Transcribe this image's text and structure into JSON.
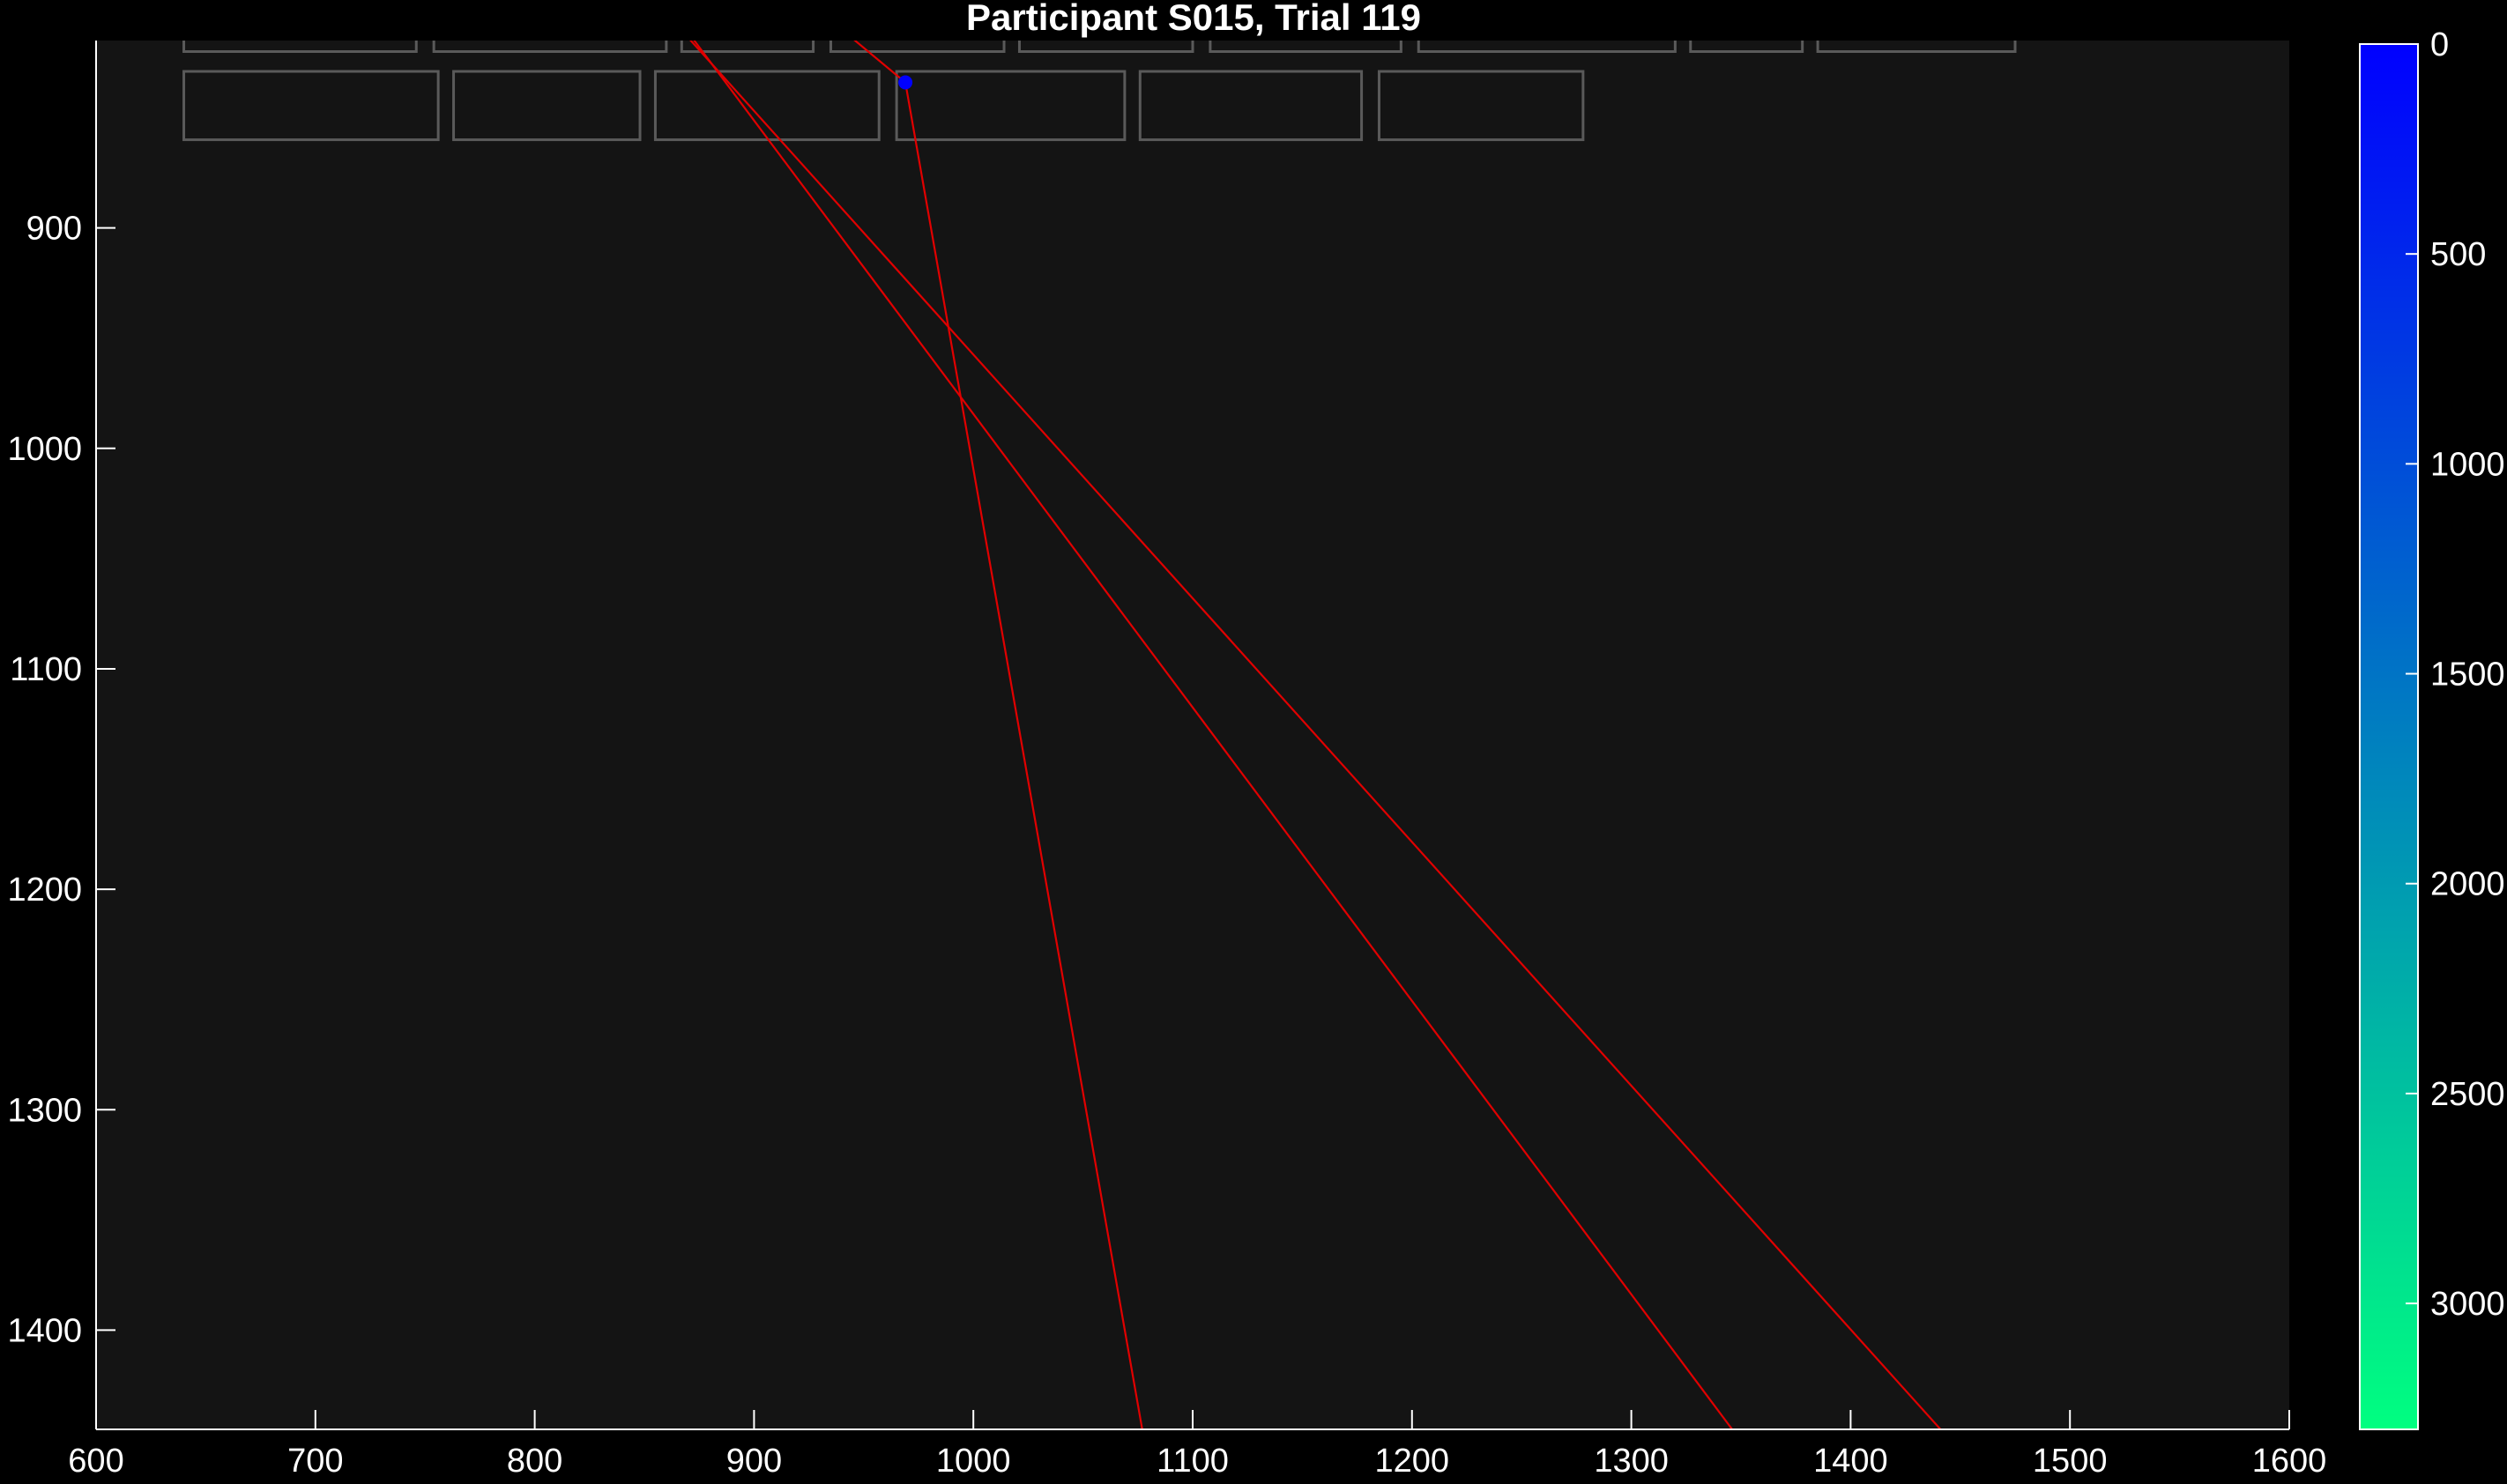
{
  "chart_data": {
    "type": "scatter",
    "title": "Participant S015, Trial 119",
    "xlabel": "",
    "ylabel": "",
    "xlim": [
      600,
      1600
    ],
    "ylim": [
      1445,
      815
    ],
    "y_direction": "reversed",
    "grid": false,
    "x_ticks": [
      600,
      700,
      800,
      900,
      1000,
      1100,
      1200,
      1300,
      1400,
      1500,
      1600
    ],
    "y_ticks": [
      900,
      1000,
      1100,
      1200,
      1300,
      1400
    ],
    "colors": {
      "background": "#000000",
      "axes_background": "#141414",
      "axis": "#ffffff",
      "text_boxes": "#5a5a5a",
      "saccade_line": "#e00000",
      "fixation_start": "#0000ff"
    },
    "text_boxes": [
      {
        "row": 1,
        "x0": 640,
        "x1": 746,
        "y0": 791,
        "y1": 820
      },
      {
        "row": 1,
        "x0": 754,
        "x1": 860,
        "y0": 791,
        "y1": 820
      },
      {
        "row": 1,
        "x0": 867,
        "x1": 927,
        "y0": 791,
        "y1": 820
      },
      {
        "row": 1,
        "x0": 935,
        "x1": 1014,
        "y0": 791,
        "y1": 820
      },
      {
        "row": 1,
        "x0": 1021,
        "x1": 1100,
        "y0": 791,
        "y1": 820
      },
      {
        "row": 1,
        "x0": 1108,
        "x1": 1195,
        "y0": 791,
        "y1": 820
      },
      {
        "row": 1,
        "x0": 1203,
        "x1": 1320,
        "y0": 791,
        "y1": 820
      },
      {
        "row": 1,
        "x0": 1327,
        "x1": 1378,
        "y0": 791,
        "y1": 820
      },
      {
        "row": 1,
        "x0": 1385,
        "x1": 1475,
        "y0": 791,
        "y1": 820
      },
      {
        "row": 2,
        "x0": 640,
        "x1": 756,
        "y0": 829,
        "y1": 860
      },
      {
        "row": 2,
        "x0": 763,
        "x1": 848,
        "y0": 829,
        "y1": 860
      },
      {
        "row": 2,
        "x0": 855,
        "x1": 957,
        "y0": 829,
        "y1": 860
      },
      {
        "row": 2,
        "x0": 965,
        "x1": 1069,
        "y0": 829,
        "y1": 860
      },
      {
        "row": 2,
        "x0": 1076,
        "x1": 1177,
        "y0": 829,
        "y1": 860
      },
      {
        "row": 2,
        "x0": 1185,
        "x1": 1278,
        "y0": 829,
        "y1": 860
      }
    ],
    "saccades": [
      {
        "x": [
          863,
          1441
        ],
        "y": [
          806,
          1445
        ]
      },
      {
        "x": [
          866,
          1346
        ],
        "y": [
          806,
          1445
        ]
      },
      {
        "x": [
          940,
          969,
          1077
        ],
        "y": [
          810,
          834,
          1445
        ]
      }
    ],
    "fixations": [
      {
        "x": 969,
        "y": 834,
        "time": 0
      }
    ],
    "colorbar": {
      "range": [
        0,
        3300
      ],
      "ticks": [
        0,
        500,
        1000,
        1500,
        2000,
        2500,
        3000
      ],
      "tick_labels": [
        "0",
        "500",
        "1000",
        "1500",
        "2000",
        "2500",
        "3000"
      ],
      "color_start": "#0000ff",
      "color_end": "#00ff80",
      "direction": "reversed"
    }
  }
}
